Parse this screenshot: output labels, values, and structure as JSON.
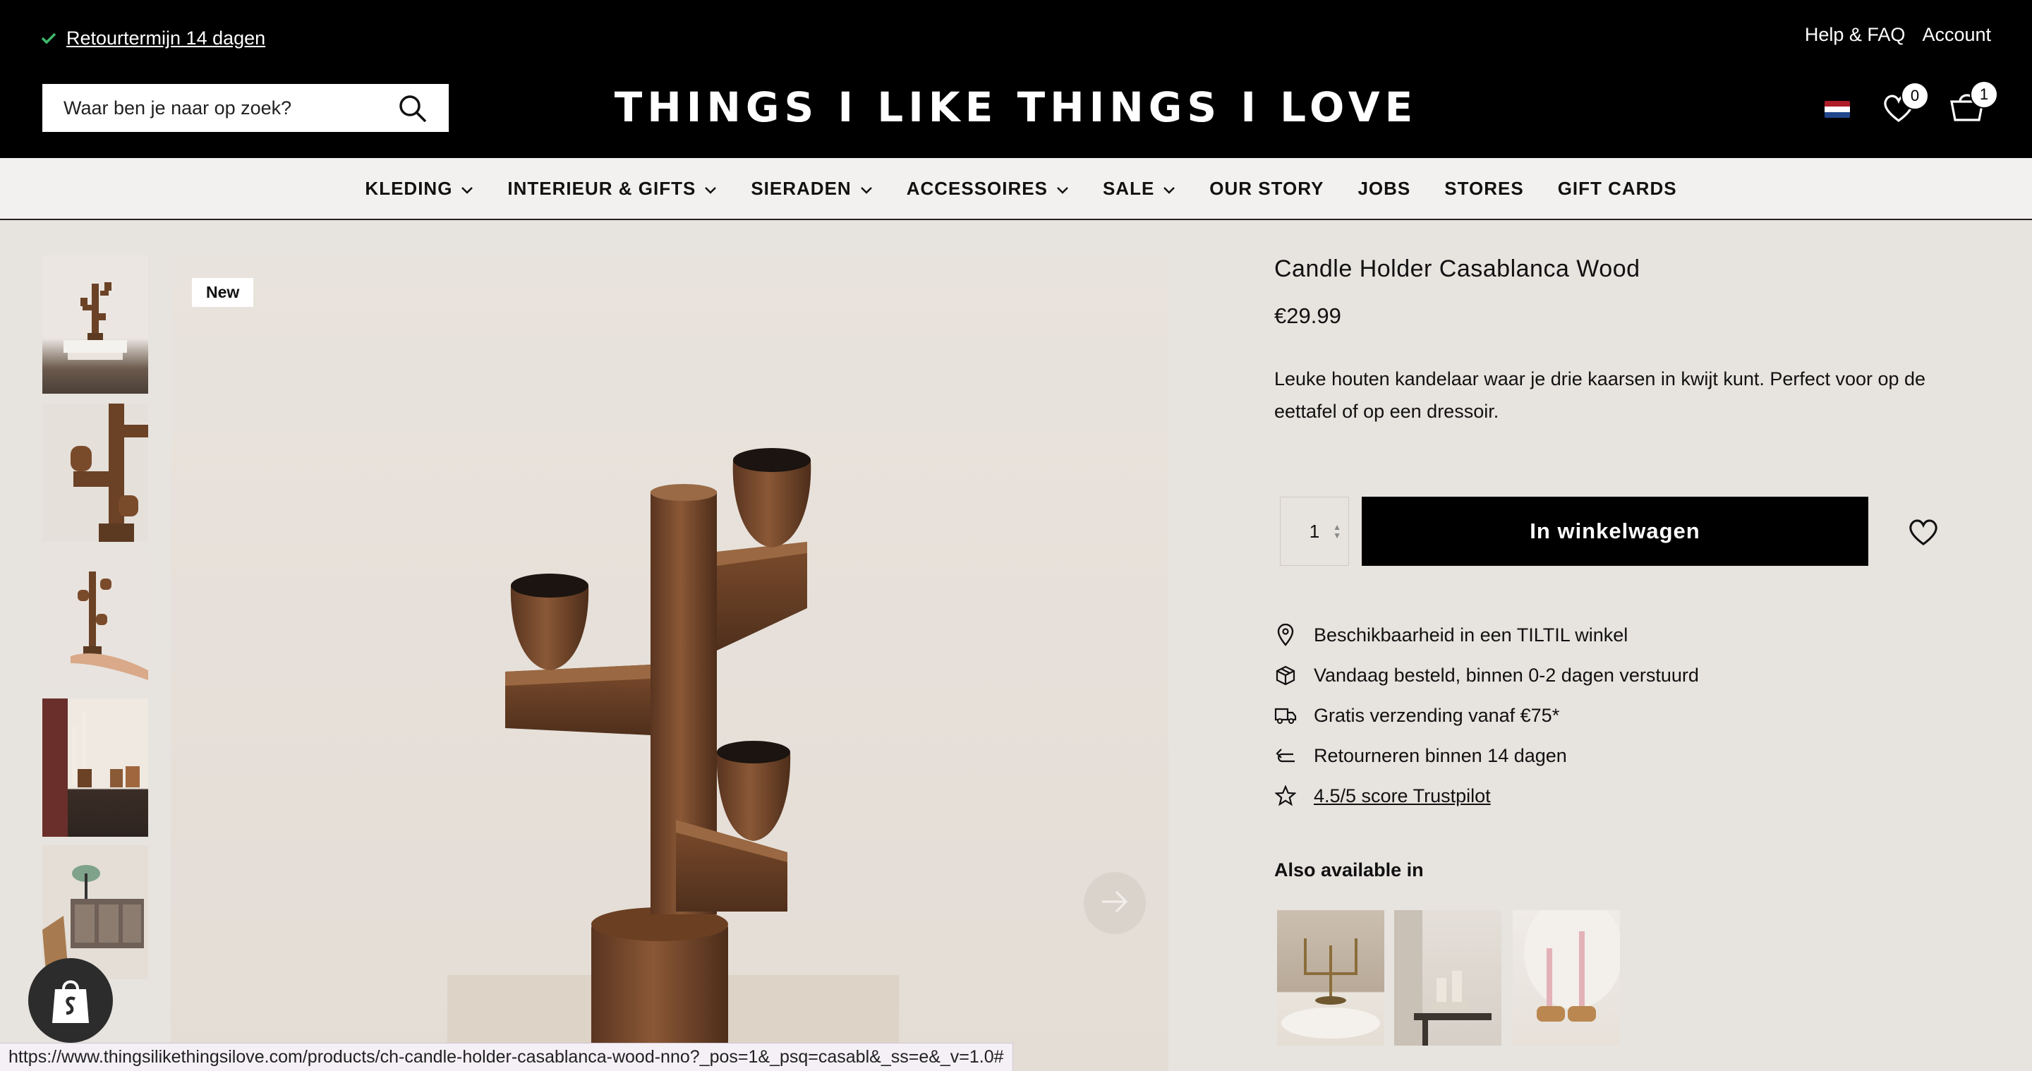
{
  "announcement": {
    "text": "Retourtermijn 14 dagen"
  },
  "top_links": {
    "help": "Help & FAQ",
    "account": "Account"
  },
  "search": {
    "placeholder": "Waar ben je naar op zoek?"
  },
  "brand": {
    "logo_text": "THINGS I LIKE THINGS I LOVE"
  },
  "header_icons": {
    "wishlist_count": "0",
    "cart_count": "1",
    "flag": "netherlands-flag-icon"
  },
  "nav": {
    "items": [
      {
        "label": "KLEDING",
        "has_dropdown": true
      },
      {
        "label": "INTERIEUR & GIFTS",
        "has_dropdown": true
      },
      {
        "label": "SIERADEN",
        "has_dropdown": true
      },
      {
        "label": "ACCESSOIRES",
        "has_dropdown": true
      },
      {
        "label": "SALE",
        "has_dropdown": true
      },
      {
        "label": "OUR STORY",
        "has_dropdown": false
      },
      {
        "label": "JOBS",
        "has_dropdown": false
      },
      {
        "label": "STORES",
        "has_dropdown": false
      },
      {
        "label": "GIFT CARDS",
        "has_dropdown": false
      }
    ]
  },
  "gallery": {
    "badge": "New",
    "thumbnail_count": 5
  },
  "product": {
    "title": "Candle Holder Casablanca Wood",
    "price": "€29.99",
    "description": "Leuke houten kandelaar waar je drie kaarsen in kwijt kunt.   Perfect voor op de eettafel of op een dressoir.",
    "quantity": "1",
    "add_to_cart": "In winkelwagen"
  },
  "features": [
    {
      "icon": "location-pin-icon",
      "text": "Beschikbaarheid in een TILTIL winkel"
    },
    {
      "icon": "package-icon",
      "text": "Vandaag besteld, binnen 0-2 dagen verstuurd"
    },
    {
      "icon": "truck-icon",
      "text": "Gratis verzending vanaf €75*"
    },
    {
      "icon": "return-arrow-icon",
      "text": "Retourneren binnen 14 dagen"
    },
    {
      "icon": "star-icon",
      "text": "4.5/5 score Trustpilot"
    }
  ],
  "also_available": {
    "title": "Also available in",
    "variant_count": 3
  },
  "status_bar": {
    "url": "https://www.thingsilikethingsilove.com/products/ch-candle-holder-casablanca-wood-nno?_pos=1&_psq=casabl&_ss=e&_v=1.0#"
  },
  "colors": {
    "header_bg": "#000000",
    "page_bg": "#e7e3df",
    "nav_bg": "#f3f1ef",
    "accent_wood": "#6b4226"
  }
}
